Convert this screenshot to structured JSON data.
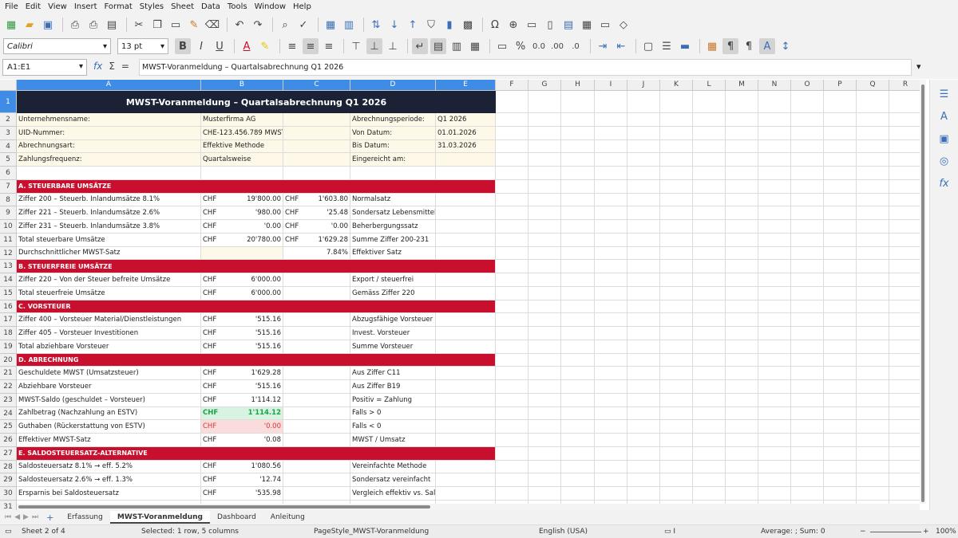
{
  "menu": [
    "File",
    "Edit",
    "View",
    "Insert",
    "Format",
    "Styles",
    "Sheet",
    "Data",
    "Tools",
    "Window",
    "Help"
  ],
  "toolbar": {
    "font_name": "Calibri",
    "font_size": "13 pt",
    "bold": "B",
    "italic": "I",
    "underline": "U",
    "percent": "%",
    "number_format": "0.0",
    "add_decimal": ".00",
    "remove_decimal": ".0"
  },
  "formula_bar": {
    "name_box": "A1:E1",
    "content": "MWST-Voranmeldung – Quartalsabrechnung Q1 2026"
  },
  "columns": [
    "A",
    "B",
    "C",
    "D",
    "E",
    "F",
    "G",
    "H",
    "I",
    "J",
    "K",
    "L",
    "M",
    "N",
    "O",
    "P",
    "Q",
    "R"
  ],
  "rows": [
    {
      "n": "1",
      "kind": "title",
      "a": "MWST-Voranmeldung – Quartalsabrechnung Q1 2026"
    },
    {
      "n": "2",
      "kind": "info",
      "a": "Unternehmensname:",
      "b": "Musterfirma AG",
      "d": "Abrechnungsperiode:",
      "e": "Q1 2026"
    },
    {
      "n": "3",
      "kind": "info",
      "a": "UID-Nummer:",
      "b": "CHE-123.456.789 MWST",
      "d": "Von Datum:",
      "e": "01.01.2026"
    },
    {
      "n": "4",
      "kind": "info",
      "a": "Abrechnungsart:",
      "b": "Effektive Methode",
      "d": "Bis Datum:",
      "e": "31.03.2026"
    },
    {
      "n": "5",
      "kind": "info",
      "a": "Zahlungsfrequenz:",
      "b": "Quartalsweise",
      "d": "Eingereicht am:",
      "e": ""
    },
    {
      "n": "6",
      "kind": "blank"
    },
    {
      "n": "7",
      "kind": "sect",
      "a": "A. STEUERBARE UMSÄTZE"
    },
    {
      "n": "8",
      "kind": "data",
      "a": "Ziffer 200 – Steuerb. Inlandumsätze 8.1%",
      "bc": "CHF",
      "bv": "19'800.00",
      "cc": "CHF",
      "cv": "1'603.80",
      "d": "Normalsatz"
    },
    {
      "n": "9",
      "kind": "data",
      "a": "Ziffer 221 – Steuerb. Inlandumsätze 2.6%",
      "bc": "CHF",
      "bv": "'980.00",
      "cc": "CHF",
      "cv": "'25.48",
      "d": "Sondersatz Lebensmittel"
    },
    {
      "n": "10",
      "kind": "data",
      "a": "Ziffer 231 – Steuerb. Inlandumsätze 3.8%",
      "bc": "CHF",
      "bv": "'0.00",
      "cc": "CHF",
      "cv": "'0.00",
      "d": "Beherbergungssatz"
    },
    {
      "n": "11",
      "kind": "data",
      "a": "Total steuerbare Umsätze",
      "bc": "CHF",
      "bv": "20'780.00",
      "cc": "CHF",
      "cv": "1'629.28",
      "d": "Summe Ziffer 200-231"
    },
    {
      "n": "12",
      "kind": "data",
      "a": "Durchschnittlicher MWST-Satz",
      "binfo": true,
      "cv": "7.84%",
      "d": "Effektiver Satz"
    },
    {
      "n": "13",
      "kind": "sect",
      "a": "B. STEUERFREIE UMSÄTZE"
    },
    {
      "n": "14",
      "kind": "data",
      "a": "Ziffer 220 – Von der Steuer befreite Umsätze",
      "bc": "CHF",
      "bv": "6'000.00",
      "d": "Export / steuerfrei"
    },
    {
      "n": "15",
      "kind": "data",
      "a": "Total steuerfreie Umsätze",
      "bc": "CHF",
      "bv": "6'000.00",
      "d": "Gemäss Ziffer 220"
    },
    {
      "n": "16",
      "kind": "sect",
      "a": "C. VORSTEUER"
    },
    {
      "n": "17",
      "kind": "data",
      "a": "Ziffer 400 – Vorsteuer Material/Dienstleistungen",
      "bc": "CHF",
      "bv": "'515.16",
      "d": "Abzugsfähige Vorsteuer"
    },
    {
      "n": "18",
      "kind": "data",
      "a": "Ziffer 405 – Vorsteuer Investitionen",
      "bc": "CHF",
      "bv": "'515.16",
      "d": "Invest. Vorsteuer"
    },
    {
      "n": "19",
      "kind": "data",
      "a": "Total abziehbare Vorsteuer",
      "bc": "CHF",
      "bv": "'515.16",
      "d": "Summe Vorsteuer"
    },
    {
      "n": "20",
      "kind": "sect",
      "a": "D. ABRECHNUNG"
    },
    {
      "n": "21",
      "kind": "data",
      "a": "Geschuldete MWST (Umsatzsteuer)",
      "bc": "CHF",
      "bv": "1'629.28",
      "d": "Aus Ziffer C11"
    },
    {
      "n": "22",
      "kind": "data",
      "a": "Abziehbare Vorsteuer",
      "bc": "CHF",
      "bv": "'515.16",
      "d": "Aus Ziffer B19"
    },
    {
      "n": "23",
      "kind": "data",
      "a": "MWST-Saldo (geschuldet – Vorsteuer)",
      "bc": "CHF",
      "bv": "1'114.12",
      "d": "Positiv = Zahlung"
    },
    {
      "n": "24",
      "kind": "data",
      "a": "Zahlbetrag (Nachzahlung an ESTV)",
      "bc": "CHF",
      "bv": "1'114.12",
      "d": "Falls > 0",
      "bstyle": "good"
    },
    {
      "n": "25",
      "kind": "data",
      "a": "Guthaben (Rückerstattung von ESTV)",
      "bc": "CHF",
      "bv": "'0.00",
      "d": "Falls < 0",
      "bstyle": "bad"
    },
    {
      "n": "26",
      "kind": "data",
      "a": "Effektiver MWST-Satz",
      "bc": "CHF",
      "bv": "'0.08",
      "d": "MWST / Umsatz"
    },
    {
      "n": "27",
      "kind": "sect",
      "a": "E. SALDOSTEUERSATZ-ALTERNATIVE"
    },
    {
      "n": "28",
      "kind": "data",
      "a": "Saldosteuersatz 8.1% → eff. 5.2%",
      "bc": "CHF",
      "bv": "1'080.56",
      "d": "Vereinfachte Methode"
    },
    {
      "n": "29",
      "kind": "data",
      "a": "Saldosteuersatz 2.6% → eff. 1.3%",
      "bc": "CHF",
      "bv": "'12.74",
      "d": "Sondersatz vereinfacht"
    },
    {
      "n": "30",
      "kind": "data",
      "a": "Ersparnis bei Saldosteuersatz",
      "bc": "CHF",
      "bv": "'535.98",
      "d": "Vergleich effektiv vs. Saldo"
    },
    {
      "n": "31",
      "kind": "blank"
    }
  ],
  "sheet_tabs": [
    "Erfassung",
    "MWST-Voranmeldung",
    "Dashboard",
    "Anleitung"
  ],
  "active_tab": "MWST-Voranmeldung",
  "status": {
    "sheet": "Sheet 2 of 4",
    "selection": "Selected: 1 row, 5 columns",
    "page_style": "PageStyle_MWST-Voranmeldung",
    "language": "English (USA)",
    "summary": "Average: ; Sum: 0",
    "zoom": "100%"
  }
}
